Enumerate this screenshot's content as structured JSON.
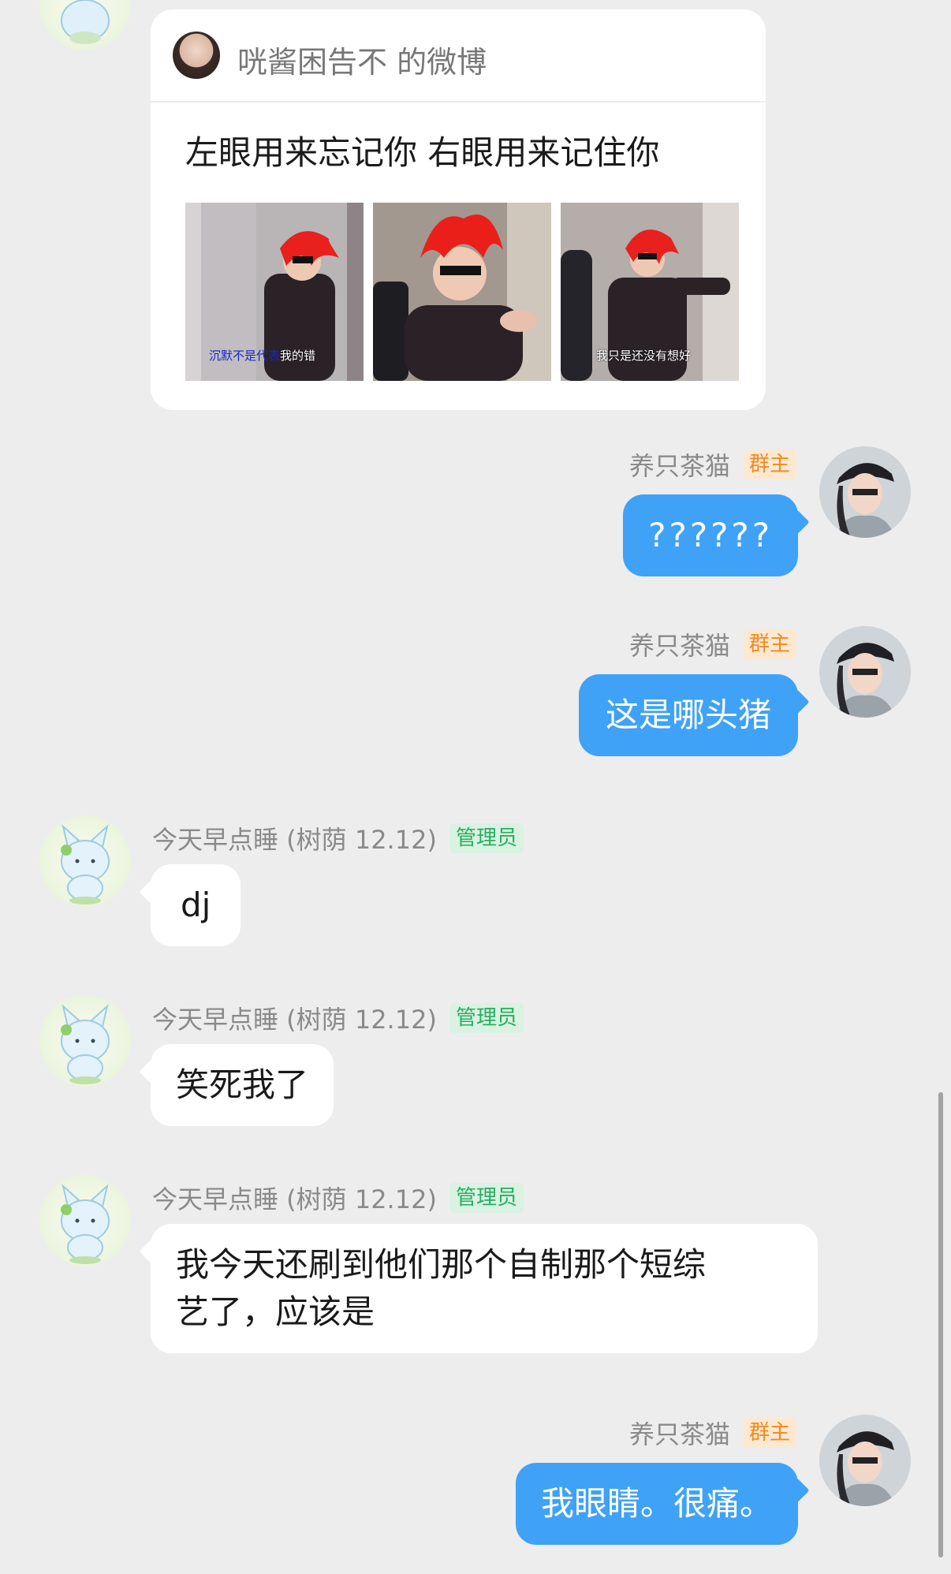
{
  "card": {
    "author": "咣酱困告不 的微博",
    "text": "左眼用来忘记你 右眼用来记住你",
    "captions": [
      {
        "highlight": "沉默不是代表",
        "rest": "我的错"
      },
      {
        "highlight": "",
        "rest": ""
      },
      {
        "highlight": "",
        "rest": "我只是还没有想好"
      }
    ]
  },
  "users": {
    "owner": {
      "name": "养只茶猫",
      "badge": "群主"
    },
    "admin": {
      "name": "今天早点睡 (树荫 12.12)",
      "badge": "管理员"
    }
  },
  "messages": [
    {
      "text": "??????"
    },
    {
      "text": "这是哪头猪"
    },
    {
      "text": "dj"
    },
    {
      "text": "笑死我了"
    },
    {
      "line1": "我今天还刷到他们那个自制那个短综",
      "line2": "艺了，应该是"
    },
    {
      "text": "我眼睛。很痛。"
    }
  ]
}
